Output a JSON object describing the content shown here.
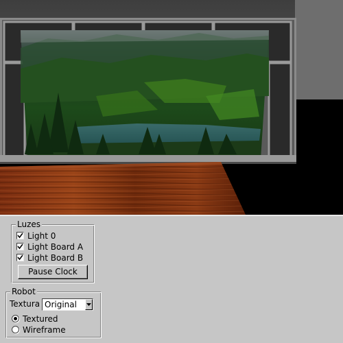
{
  "viewport": {
    "scene": "textured-room-with-landscape-window"
  },
  "luzes": {
    "title": "Luzes",
    "items": [
      {
        "label": "Light 0",
        "checked": true
      },
      {
        "label": "Light Board A",
        "checked": true
      },
      {
        "label": "Light Board B",
        "checked": true
      }
    ],
    "pause_button": "Pause Clock"
  },
  "robot": {
    "title": "Robot",
    "textura_label": "Textura",
    "textura_value": "Original",
    "options": [
      {
        "label": "Textured",
        "selected": true
      },
      {
        "label": "Wireframe",
        "selected": false
      }
    ]
  }
}
